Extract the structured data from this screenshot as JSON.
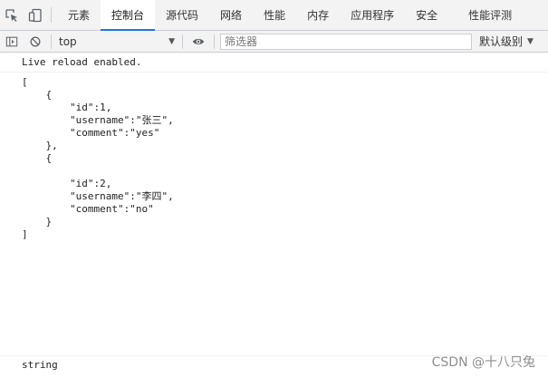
{
  "tabs": [
    {
      "label": "元素"
    },
    {
      "label": "控制台"
    },
    {
      "label": "源代码"
    },
    {
      "label": "网络"
    },
    {
      "label": "性能"
    },
    {
      "label": "内存"
    },
    {
      "label": "应用程序"
    },
    {
      "label": "安全"
    },
    {
      "label": "性能评测"
    }
  ],
  "active_tab": "控制台",
  "toolbar": {
    "context": "top",
    "filter_placeholder": "筛选器",
    "levels_label": "默认级别"
  },
  "console": {
    "live_reload": "Live reload enabled.",
    "json_output": "[\n    {\n        \"id\":1,\n        \"username\":\"张三\",\n        \"comment\":\"yes\"\n    },\n    {\n\n        \"id\":2,\n        \"username\":\"李四\",\n        \"comment\":\"no\"\n    }\n]",
    "bottom_line": "string"
  },
  "watermark": "CSDN @十八只兔",
  "colors": {
    "active_tab_underline": "#1a73e8",
    "toolbar_bg": "#f3f3f3",
    "border": "#cbcdd1"
  },
  "icons": {
    "inspect": "inspect-element-icon",
    "device": "device-toolbar-icon",
    "sidebar": "show-sidebar-icon",
    "clear": "clear-console-icon",
    "eye": "live-expression-eye-icon"
  }
}
